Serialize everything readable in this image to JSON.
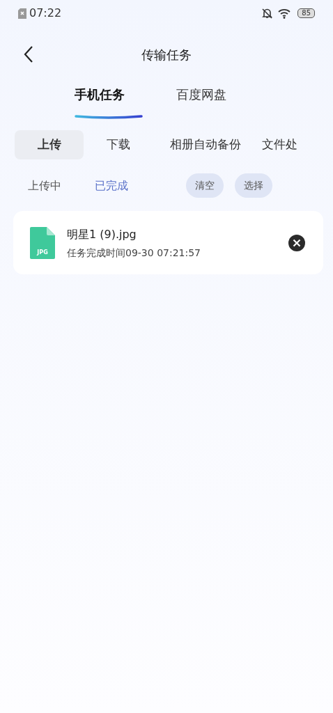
{
  "status_bar": {
    "time": "07:22",
    "battery": "85"
  },
  "header": {
    "title": "传输任务"
  },
  "main_tabs": [
    {
      "label": "手机任务",
      "selected": true
    },
    {
      "label": "百度网盘",
      "selected": false
    }
  ],
  "category_tabs": [
    {
      "label": "上传",
      "selected": true
    },
    {
      "label": "下载",
      "selected": false
    },
    {
      "label": "相册自动备份",
      "selected": false
    },
    {
      "label": "文件处",
      "selected": false
    }
  ],
  "sub_tabs": [
    {
      "label": "上传中",
      "selected": false
    },
    {
      "label": "已完成",
      "selected": true
    }
  ],
  "actions": [
    "清空",
    "选择"
  ],
  "tasks": [
    {
      "file_type": "JPG",
      "name": "明星1 (9).jpg",
      "detail": "任务完成时间09-30 07:21:57"
    }
  ]
}
